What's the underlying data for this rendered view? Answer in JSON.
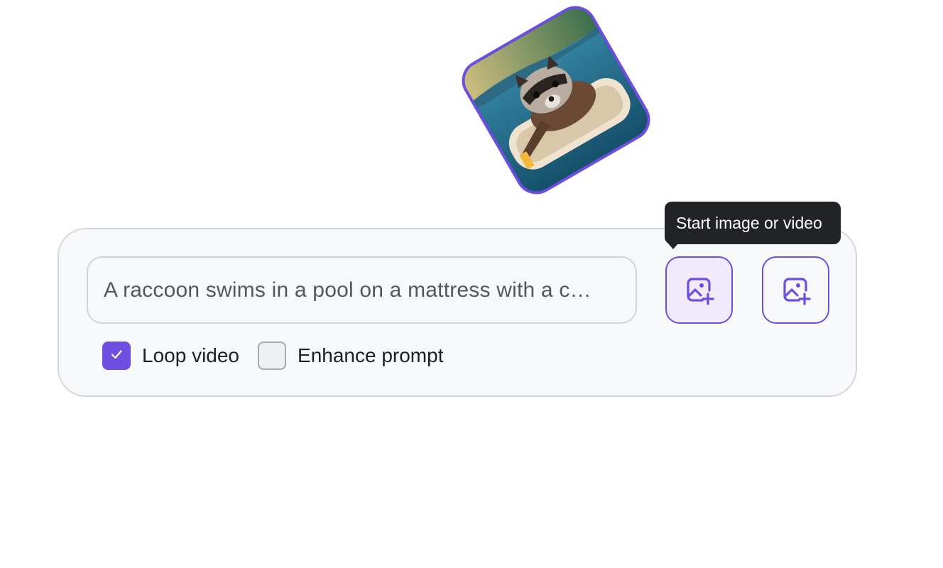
{
  "theme": {
    "accent": "#6d4ee0",
    "panel_bg": "#f7f8fa",
    "tooltip_bg": "#212326"
  },
  "preview": {
    "icon": "raccoon-pool-image"
  },
  "prompt": {
    "value": "A raccoon swims in a pool on a mattress with a cocktail",
    "display": "A raccoon swims in a pool on a mattress with a c…"
  },
  "media_buttons": {
    "start_icon": "image-add-icon",
    "end_icon": "image-add-icon"
  },
  "tooltip": {
    "text": "Start image or video"
  },
  "options": {
    "loop_video": {
      "label": "Loop video",
      "checked": true
    },
    "enhance_prompt": {
      "label": "Enhance prompt",
      "checked": false
    }
  }
}
